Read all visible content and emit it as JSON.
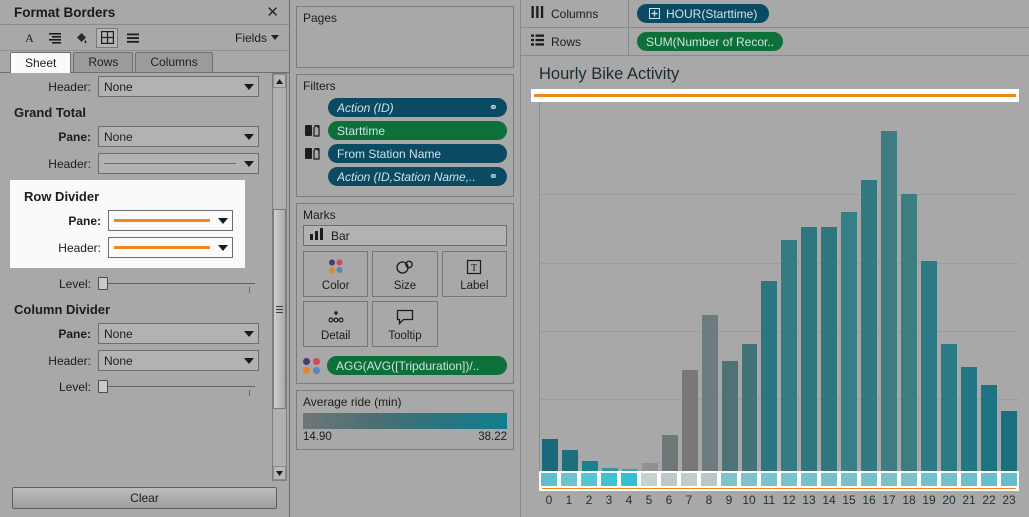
{
  "format_panel": {
    "title": "Format Borders",
    "close_icon": "close-icon",
    "toolbar": {
      "font_icon": "font-icon",
      "alignment_icon": "alignment-icon",
      "shading_icon": "shading-icon",
      "borders_icon": "borders-icon",
      "lines_icon": "lines-icon",
      "fields_label": "Fields"
    },
    "tabs": [
      {
        "label": "Sheet",
        "active": true
      },
      {
        "label": "Rows",
        "active": false
      },
      {
        "label": "Columns",
        "active": false
      }
    ],
    "sheet_header": {
      "label": "Header:",
      "value": "None"
    },
    "grand_total": {
      "title": "Grand Total",
      "pane": {
        "label": "Pane:",
        "value": "None"
      },
      "header": {
        "label": "Header:",
        "value": "line-preview-thin"
      }
    },
    "row_divider": {
      "title": "Row Divider",
      "pane": {
        "label": "Pane:",
        "value": "line-preview-orange"
      },
      "header": {
        "label": "Header:",
        "value": "line-preview-orange"
      },
      "level": {
        "label": "Level:"
      }
    },
    "column_divider": {
      "title": "Column Divider",
      "pane": {
        "label": "Pane:",
        "value": "None"
      },
      "header": {
        "label": "Header:",
        "value": "None"
      },
      "level": {
        "label": "Level:"
      }
    },
    "clear_label": "Clear",
    "scrollbar": {
      "up_icon": "scroll-up-icon",
      "down_icon": "scroll-down-icon"
    }
  },
  "cards": {
    "pages": {
      "title": "Pages"
    },
    "filters": {
      "title": "Filters",
      "items": [
        {
          "label": "Action (ID)",
          "color": "blue",
          "italic": true,
          "end_icon": "link-icon",
          "has_db_icon": false
        },
        {
          "label": "Starttime",
          "color": "green",
          "italic": false,
          "end_icon": "",
          "has_db_icon": true
        },
        {
          "label": "From Station Name",
          "color": "blue",
          "italic": false,
          "end_icon": "",
          "has_db_icon": true
        },
        {
          "label": "Action (ID,Station Name,..",
          "color": "blue",
          "italic": true,
          "end_icon": "link-icon",
          "has_db_icon": false
        }
      ]
    },
    "marks": {
      "title": "Marks",
      "mark_type": "Bar",
      "mark_type_icon": "bar-chart-icon",
      "buttons": [
        {
          "label": "Color",
          "icon": "color-dots-icon"
        },
        {
          "label": "Size",
          "icon": "size-icon"
        },
        {
          "label": "Label",
          "icon": "label-icon"
        },
        {
          "label": "Detail",
          "icon": "detail-icon"
        },
        {
          "label": "Tooltip",
          "icon": "tooltip-icon"
        }
      ],
      "color_pill": {
        "label": "AGG(AVG([Tripduration])/..",
        "color": "green",
        "icon": "color-dots-icon"
      }
    },
    "legend": {
      "title": "Average ride (min)",
      "min": "14.90",
      "max": "38.22",
      "gradient_start": "#6f7777",
      "gradient_end": "#0f7f8e"
    }
  },
  "shelves": {
    "columns": {
      "label": "Columns",
      "icon": "columns-icon",
      "pill": {
        "label": "HOUR(Starttime)",
        "prefix_icon": "plus-box-icon",
        "color": "blue"
      }
    },
    "rows": {
      "label": "Rows",
      "icon": "rows-icon",
      "pill": {
        "label": "SUM(Number of Recor..",
        "color": "green"
      }
    }
  },
  "viz": {
    "title": "Hourly Bike Activity",
    "divider_color": "#f0871e"
  },
  "chart_data": {
    "type": "bar",
    "title": "Hourly Bike Activity",
    "xlabel": "HOUR(Starttime)",
    "ylabel": "SUM(Number of Records)",
    "categories": [
      "0",
      "1",
      "2",
      "3",
      "4",
      "5",
      "6",
      "7",
      "8",
      "9",
      "10",
      "11",
      "12",
      "13",
      "14",
      "15",
      "16",
      "17",
      "18",
      "19",
      "20",
      "21",
      "22",
      "23"
    ],
    "values": [
      28,
      18,
      9,
      3,
      2,
      7,
      31,
      88,
      135,
      95,
      110,
      165,
      200,
      212,
      212,
      225,
      252,
      295,
      240,
      182,
      110,
      90,
      75,
      52
    ],
    "ylim": [
      0,
      320
    ],
    "grid": true,
    "legend_position": "right",
    "color_legend": "Average ride (min)",
    "color_values": [
      37.5,
      36.8,
      35.2,
      33.0,
      32.0,
      24.0,
      22.0,
      15.5,
      17.0,
      19.5,
      21.5,
      23.5,
      25.5,
      26.5,
      26.5,
      27.0,
      27.5,
      26.0,
      26.5,
      27.5,
      28.5,
      30.0,
      32.5,
      35.0
    ],
    "bar_colors": [
      "#18697a",
      "#1d6f7c",
      "#17818f",
      "#2e97a3",
      "#3aa5b0",
      "#8f9292",
      "#6f7779",
      "#787878",
      "#6d7b7e",
      "#4d7377",
      "#437277",
      "#2c7680",
      "#337c84",
      "#2f777f",
      "#2f777f",
      "#367f86",
      "#327a82",
      "#3d7c81",
      "#3d7c81",
      "#2c7b86",
      "#2a7b86",
      "#217784",
      "#1d7382",
      "#1a7080"
    ],
    "axis_band_colors": [
      "#5ec0cc",
      "#6cc2cd",
      "#55c6d4",
      "#3fc2d2",
      "#35bfd0",
      "#c5d2d2",
      "#bcc9c9",
      "#c2cccc",
      "#b9c7c7",
      "#7fc4cd",
      "#7cc3cd",
      "#77c3cf",
      "#79c2cc",
      "#76c0ca",
      "#76c0ca",
      "#78c1cb",
      "#77c0ca",
      "#7ac1ca",
      "#7ac1ca",
      "#72c0cb",
      "#71c0cb",
      "#6ebfcb",
      "#6abecb",
      "#67bdca"
    ]
  }
}
